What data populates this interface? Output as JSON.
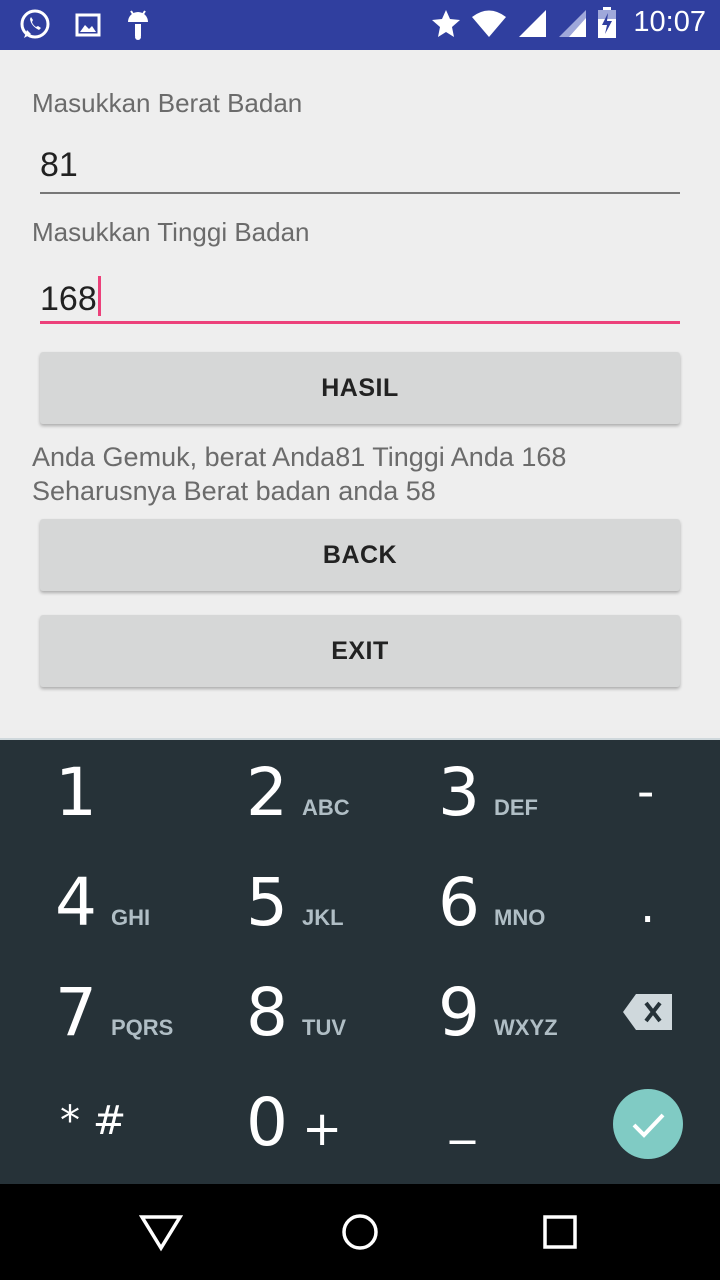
{
  "status_bar": {
    "left_icons": [
      "whatsapp-icon",
      "image-icon",
      "android-icon"
    ],
    "right_icons": [
      "star-icon",
      "wifi-icon",
      "signal-icon",
      "signal-icon",
      "battery-charging-icon"
    ],
    "time": "10:07"
  },
  "form": {
    "weight_label": "Masukkan Berat Badan",
    "weight_value": "81",
    "height_label": "Masukkan Tinggi Badan",
    "height_value": "168",
    "hasil_button": "HASIL",
    "result_text_line1": "Anda Gemuk, berat Anda81 Tinggi Anda 168",
    "result_text_line2": "Seharusnya Berat badan anda 58",
    "back_button": "BACK",
    "exit_button": "EXIT"
  },
  "keyboard": {
    "keys": [
      {
        "num": "1",
        "letters": ""
      },
      {
        "num": "2",
        "letters": "ABC"
      },
      {
        "num": "3",
        "letters": "DEF"
      },
      {
        "num": "4",
        "letters": "GHI"
      },
      {
        "num": "5",
        "letters": "JKL"
      },
      {
        "num": "6",
        "letters": "MNO"
      },
      {
        "num": "7",
        "letters": "PQRS"
      },
      {
        "num": "8",
        "letters": "TUV"
      },
      {
        "num": "9",
        "letters": "WXYZ"
      },
      {
        "num": "0",
        "letters": "+"
      }
    ],
    "minus": "-",
    "dot": ".",
    "star_hash": "* #",
    "space": "_",
    "done_color": "#80cbc4"
  },
  "colors": {
    "status_bar": "#303f9f",
    "accent": "#ec407a",
    "keyboard_bg": "#263238"
  }
}
